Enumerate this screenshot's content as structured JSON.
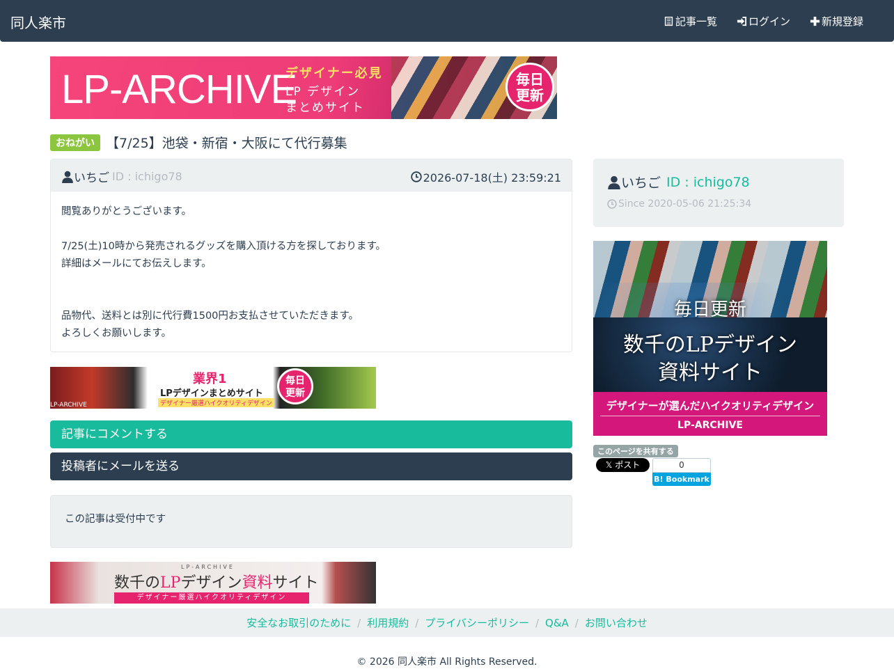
{
  "app": {
    "brand": "同人楽市"
  },
  "nav": {
    "items": [
      {
        "label": "記事一覧",
        "icon": "list-icon"
      },
      {
        "label": "ログイン",
        "icon": "login-icon"
      },
      {
        "label": "新規登録",
        "icon": "plus-icon"
      }
    ]
  },
  "banners": {
    "top": {
      "title": "LP-ARCHIVE",
      "line1": "デザイナー必見",
      "line2": "LP デザイン",
      "line3": "まとめサイト",
      "badge": [
        "毎日",
        "更新"
      ]
    },
    "middle": {
      "line1": "業界1",
      "line2": "LPデザインまとめサイト",
      "line3": "デザイナー厳選ハイクオリティデザイン",
      "tiny": "LP-ARCHIVE",
      "badge": [
        "毎日",
        "更新"
      ]
    },
    "bottom": {
      "header": "LP-ARCHIVE",
      "main_a": "数千の",
      "main_b": "LP",
      "main_c": "デザイン",
      "main_d": "資料",
      "main_e": "サイト",
      "strip": "デザイナー厳選ハイクオリティデザイン"
    },
    "side": {
      "t1": "毎日更新",
      "t2": "数千のLPデザイン",
      "t3": "資料サイト",
      "f1": "デザイナーが選んだハイクオリティデザイン",
      "f2": "LP-ARCHIVE"
    }
  },
  "post": {
    "tag": "おねがい",
    "title": "【7/25】池袋・新宿・大阪にて代行募集",
    "author": "いちご",
    "author_id": "ID : ichigo78",
    "datetime": "2026-07-18(土) 23:59:21",
    "body": [
      "閲覧ありがとうございます。",
      "",
      "7/25(土)10時から発売されるグッズを購入頂ける方を探しております。",
      "詳細はメールにてお伝えします。",
      "",
      "",
      "品物代、送料とは別に代行費1500円お支払させていただきます。",
      "よろしくお願いします。"
    ],
    "comment_button": "記事にコメントする",
    "mail_button": "投稿者にメールを送る",
    "status": "この記事は受付中です"
  },
  "sidebar": {
    "author": "いちご",
    "author_id": "ID : ichigo78",
    "since": "Since 2020-05-06 21:25:34",
    "share_label": "このページを共有する",
    "x_post": "𝕏 ポスト",
    "hatena_count": "0",
    "hatena_label": "B! Bookmark"
  },
  "footer": {
    "links": [
      "安全なお取引のために",
      "利用規約",
      "プライバシーポリシー",
      "Q&A",
      "お問い合わせ"
    ],
    "copyright": "© 2026 同人楽市 All Rights Reserved."
  },
  "colors": {
    "navbar": "#2c3e50",
    "accent": "#18bc9c",
    "tag": "#8cc63e",
    "well": "#ecf0f1"
  }
}
